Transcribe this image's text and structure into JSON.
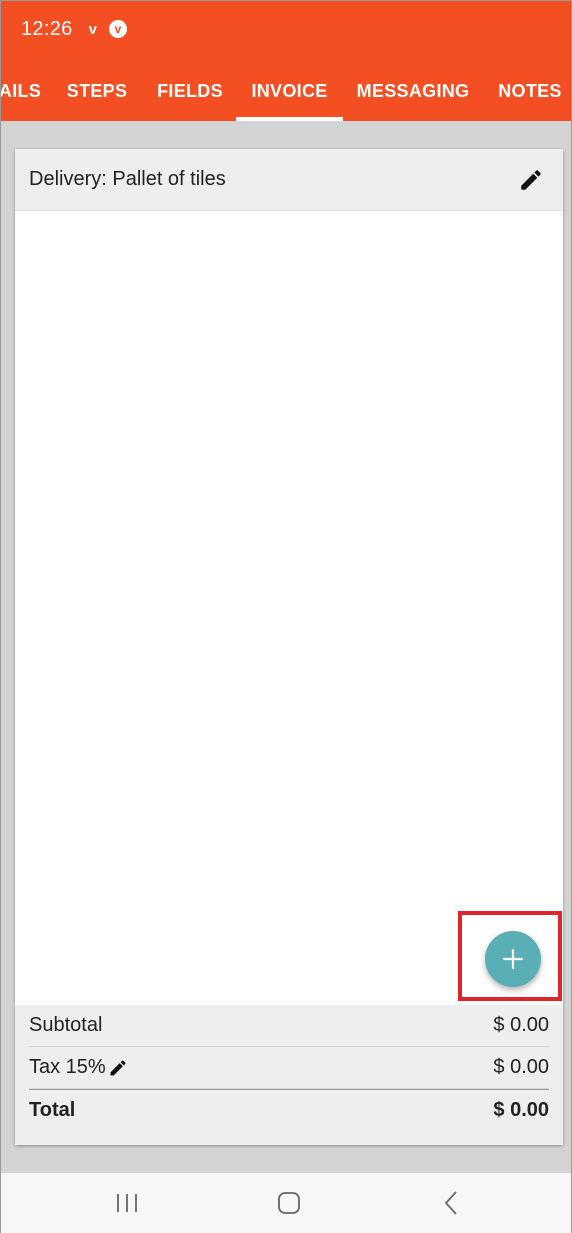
{
  "status": {
    "time": "12:26",
    "v_icon": "v",
    "vivaldi_badge": "v"
  },
  "tabs": [
    {
      "label": "AILS",
      "active": false
    },
    {
      "label": "STEPS",
      "active": false
    },
    {
      "label": "FIELDS",
      "active": false
    },
    {
      "label": "INVOICE",
      "active": true
    },
    {
      "label": "MESSAGING",
      "active": false
    },
    {
      "label": "NOTES",
      "active": false
    }
  ],
  "card": {
    "title": "Delivery: Pallet of tiles",
    "edit_icon": "pencil-icon"
  },
  "fab": {
    "icon": "plus-icon"
  },
  "totals": {
    "subtotal_label": "Subtotal",
    "subtotal_value": "$ 0.00",
    "tax_label": "Tax 15%",
    "tax_value": "$ 0.00",
    "total_label": "Total",
    "total_value": "$ 0.00"
  },
  "navbar": {
    "recents_icon": "recents-icon",
    "home_icon": "home-icon",
    "back_icon": "back-icon"
  },
  "colors": {
    "header": "#f44f22",
    "fab": "#5aafb7",
    "highlight": "#e0232f"
  }
}
